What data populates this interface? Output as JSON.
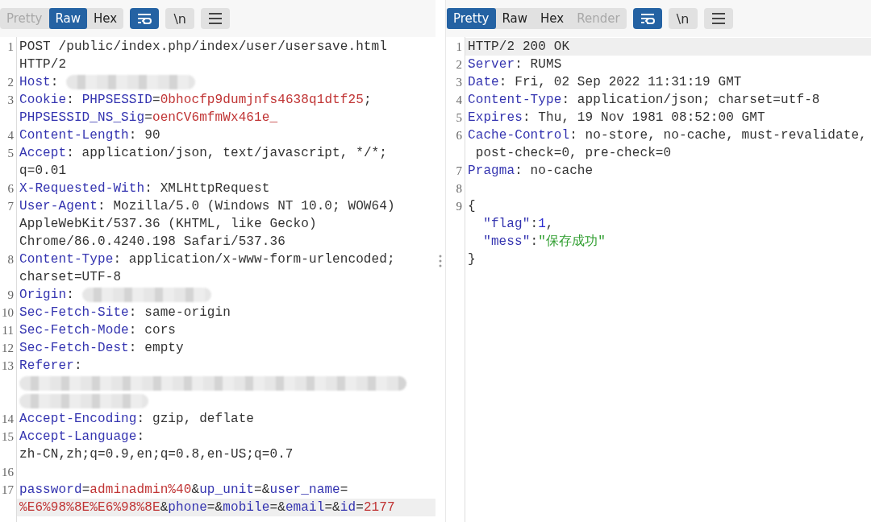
{
  "request": {
    "tabs": [
      {
        "label": "Pretty",
        "selected": false,
        "disabled": true
      },
      {
        "label": "Raw",
        "selected": true,
        "disabled": false
      },
      {
        "label": "Hex",
        "selected": false,
        "disabled": false
      }
    ],
    "tools": [
      {
        "kind": "wrap",
        "selected": true
      },
      {
        "kind": "text",
        "label": "\\n",
        "selected": false
      },
      {
        "kind": "menu",
        "selected": false
      }
    ],
    "lines": [
      {
        "number": "1",
        "highlighted": false,
        "wraps": [
          {
            "parts": [
              {
                "kind": "text",
                "text": "POST /public/index.php/index/user/usersave.html"
              }
            ]
          },
          {
            "parts": [
              {
                "kind": "text",
                "text": "HTTP/2"
              }
            ]
          }
        ]
      },
      {
        "number": "2",
        "highlighted": false,
        "wraps": [
          {
            "parts": [
              {
                "kind": "key",
                "text": "Host"
              },
              {
                "kind": "text",
                "text": ": "
              },
              {
                "kind": "redacted"
              }
            ]
          }
        ]
      },
      {
        "number": "3",
        "highlighted": false,
        "wraps": [
          {
            "parts": [
              {
                "kind": "key",
                "text": "Cookie"
              },
              {
                "kind": "text",
                "text": ": "
              },
              {
                "kind": "key",
                "text": "PHPSESSID"
              },
              {
                "kind": "text",
                "text": "="
              },
              {
                "kind": "value",
                "text": "0bhocfp9dumjnfs4638q1dtf25"
              },
              {
                "kind": "text",
                "text": ";"
              }
            ]
          },
          {
            "parts": [
              {
                "kind": "key",
                "text": "PHPSESSID_NS_Sig"
              },
              {
                "kind": "text",
                "text": "="
              },
              {
                "kind": "value",
                "text": "oenCV6mfmWx461e_"
              }
            ]
          }
        ]
      },
      {
        "number": "4",
        "highlighted": false,
        "wraps": [
          {
            "parts": [
              {
                "kind": "key",
                "text": "Content-Length"
              },
              {
                "kind": "text",
                "text": ": 90"
              }
            ]
          }
        ]
      },
      {
        "number": "5",
        "highlighted": false,
        "wraps": [
          {
            "parts": [
              {
                "kind": "key",
                "text": "Accept"
              },
              {
                "kind": "text",
                "text": ": application/json, text/javascript, */*;"
              }
            ]
          },
          {
            "parts": [
              {
                "kind": "text",
                "text": "q=0.01"
              }
            ]
          }
        ]
      },
      {
        "number": "6",
        "highlighted": false,
        "wraps": [
          {
            "parts": [
              {
                "kind": "key",
                "text": "X-Requested-With"
              },
              {
                "kind": "text",
                "text": ": XMLHttpRequest"
              }
            ]
          }
        ]
      },
      {
        "number": "7",
        "highlighted": false,
        "wraps": [
          {
            "parts": [
              {
                "kind": "key",
                "text": "User-Agent"
              },
              {
                "kind": "text",
                "text": ": Mozilla/5.0 (Windows NT 10.0; WOW64)"
              }
            ]
          },
          {
            "parts": [
              {
                "kind": "text",
                "text": "AppleWebKit/537.36 (KHTML, like Gecko)"
              }
            ]
          },
          {
            "parts": [
              {
                "kind": "text",
                "text": "Chrome/86.0.4240.198 Safari/537.36"
              }
            ]
          }
        ]
      },
      {
        "number": "8",
        "highlighted": false,
        "wraps": [
          {
            "parts": [
              {
                "kind": "key",
                "text": "Content-Type"
              },
              {
                "kind": "text",
                "text": ": application/x-www-form-urlencoded;"
              }
            ]
          },
          {
            "parts": [
              {
                "kind": "text",
                "text": "charset=UTF-8"
              }
            ]
          }
        ]
      },
      {
        "number": "9",
        "highlighted": false,
        "wraps": [
          {
            "parts": [
              {
                "kind": "key",
                "text": "Origin"
              },
              {
                "kind": "text",
                "text": ": "
              },
              {
                "kind": "redacted"
              }
            ]
          }
        ]
      },
      {
        "number": "10",
        "highlighted": false,
        "wraps": [
          {
            "parts": [
              {
                "kind": "key",
                "text": "Sec-Fetch-Site"
              },
              {
                "kind": "text",
                "text": ": same-origin"
              }
            ]
          }
        ]
      },
      {
        "number": "11",
        "highlighted": false,
        "wraps": [
          {
            "parts": [
              {
                "kind": "key",
                "text": "Sec-Fetch-Mode"
              },
              {
                "kind": "text",
                "text": ": cors"
              }
            ]
          }
        ]
      },
      {
        "number": "12",
        "highlighted": false,
        "wraps": [
          {
            "parts": [
              {
                "kind": "key",
                "text": "Sec-Fetch-Dest"
              },
              {
                "kind": "text",
                "text": ": empty"
              }
            ]
          }
        ]
      },
      {
        "number": "13",
        "highlighted": false,
        "wraps": [
          {
            "parts": [
              {
                "kind": "key",
                "text": "Referer"
              },
              {
                "kind": "text",
                "text": ":"
              }
            ]
          },
          {
            "parts": [
              {
                "kind": "redacted_wide"
              }
            ]
          },
          {
            "parts": [
              {
                "kind": "redacted"
              }
            ]
          }
        ]
      },
      {
        "number": "14",
        "highlighted": false,
        "wraps": [
          {
            "parts": [
              {
                "kind": "key",
                "text": "Accept-Encoding"
              },
              {
                "kind": "text",
                "text": ": gzip, deflate"
              }
            ]
          }
        ]
      },
      {
        "number": "15",
        "highlighted": false,
        "wraps": [
          {
            "parts": [
              {
                "kind": "key",
                "text": "Accept-Language"
              },
              {
                "kind": "text",
                "text": ":"
              }
            ]
          },
          {
            "parts": [
              {
                "kind": "text",
                "text": "zh-CN,zh;q=0.9,en;q=0.8,en-US;q=0.7"
              }
            ]
          }
        ]
      },
      {
        "number": "16",
        "highlighted": false
      },
      {
        "number": "17",
        "highlighted": true,
        "wraps": [
          {
            "parts": [
              {
                "kind": "key",
                "text": "password"
              },
              {
                "kind": "text",
                "text": "="
              },
              {
                "kind": "value",
                "text": "adminadmin%40"
              },
              {
                "kind": "text",
                "text": "&"
              },
              {
                "kind": "key",
                "text": "up_unit"
              },
              {
                "kind": "text",
                "text": "=&"
              },
              {
                "kind": "key",
                "text": "user_name"
              },
              {
                "kind": "text",
                "text": "="
              }
            ]
          },
          {
            "parts": [
              {
                "kind": "value",
                "text": "%E6%98%8E%E6%98%8E"
              },
              {
                "kind": "text",
                "text": "&"
              },
              {
                "kind": "key",
                "text": "phone"
              },
              {
                "kind": "text",
                "text": "=&"
              },
              {
                "kind": "key",
                "text": "mobile"
              },
              {
                "kind": "text",
                "text": "=&"
              },
              {
                "kind": "key",
                "text": "email"
              },
              {
                "kind": "text",
                "text": "=&"
              },
              {
                "kind": "key",
                "text": "id"
              },
              {
                "kind": "text",
                "text": "="
              },
              {
                "kind": "value",
                "text": "2177"
              }
            ]
          }
        ]
      }
    ]
  },
  "response": {
    "tabs": [
      {
        "label": "Pretty",
        "selected": true,
        "disabled": false
      },
      {
        "label": "Raw",
        "selected": false,
        "disabled": false
      },
      {
        "label": "Hex",
        "selected": false,
        "disabled": false
      },
      {
        "label": "Render",
        "selected": false,
        "disabled": true
      }
    ],
    "tools": [
      {
        "kind": "wrap",
        "selected": true
      },
      {
        "kind": "text",
        "label": "\\n",
        "selected": false
      },
      {
        "kind": "menu",
        "selected": false
      }
    ],
    "lines": [
      {
        "number": "1",
        "highlighted": true,
        "wraps": [
          {
            "parts": [
              {
                "kind": "text",
                "text": "HTTP/2 200 OK"
              }
            ]
          }
        ]
      },
      {
        "number": "2",
        "highlighted": false,
        "wraps": [
          {
            "parts": [
              {
                "kind": "key",
                "text": "Server"
              },
              {
                "kind": "text",
                "text": ": RUMS"
              }
            ]
          }
        ]
      },
      {
        "number": "3",
        "highlighted": false,
        "wraps": [
          {
            "parts": [
              {
                "kind": "key",
                "text": "Date"
              },
              {
                "kind": "text",
                "text": ": Fri, 02 Sep 2022 11:31:19 GMT"
              }
            ]
          }
        ]
      },
      {
        "number": "4",
        "highlighted": false,
        "wraps": [
          {
            "parts": [
              {
                "kind": "key",
                "text": "Content-Type"
              },
              {
                "kind": "text",
                "text": ": application/json; charset=utf-8"
              }
            ]
          }
        ]
      },
      {
        "number": "5",
        "highlighted": false,
        "wraps": [
          {
            "parts": [
              {
                "kind": "key",
                "text": "Expires"
              },
              {
                "kind": "text",
                "text": ": Thu, 19 Nov 1981 08:52:00 GMT"
              }
            ]
          }
        ]
      },
      {
        "number": "6",
        "highlighted": false,
        "wraps": [
          {
            "parts": [
              {
                "kind": "key",
                "text": "Cache-Control"
              },
              {
                "kind": "text",
                "text": ": no-store, no-cache, must-revalidate,"
              }
            ]
          },
          {
            "parts": [
              {
                "kind": "text",
                "text": " post-check=0, pre-check=0"
              }
            ]
          }
        ]
      },
      {
        "number": "7",
        "highlighted": false,
        "wraps": [
          {
            "parts": [
              {
                "kind": "key",
                "text": "Pragma"
              },
              {
                "kind": "text",
                "text": ": no-cache"
              }
            ]
          }
        ]
      },
      {
        "number": "8",
        "highlighted": false
      },
      {
        "number": "9",
        "highlighted": false,
        "wraps": [
          {
            "parts": [
              {
                "kind": "text",
                "text": "{"
              }
            ]
          },
          {
            "parts": [
              {
                "kind": "indent"
              },
              {
                "kind": "key",
                "text": "\"flag\""
              },
              {
                "kind": "text",
                "text": ":"
              },
              {
                "kind": "number",
                "text": "1"
              },
              {
                "kind": "text",
                "text": ","
              }
            ]
          },
          {
            "parts": [
              {
                "kind": "indent"
              },
              {
                "kind": "key",
                "text": "\"mess\""
              },
              {
                "kind": "text",
                "text": ":"
              },
              {
                "kind": "string",
                "text": "\"保存成功\""
              }
            ]
          },
          {
            "parts": [
              {
                "kind": "text",
                "text": "}"
              }
            ]
          }
        ]
      }
    ]
  }
}
